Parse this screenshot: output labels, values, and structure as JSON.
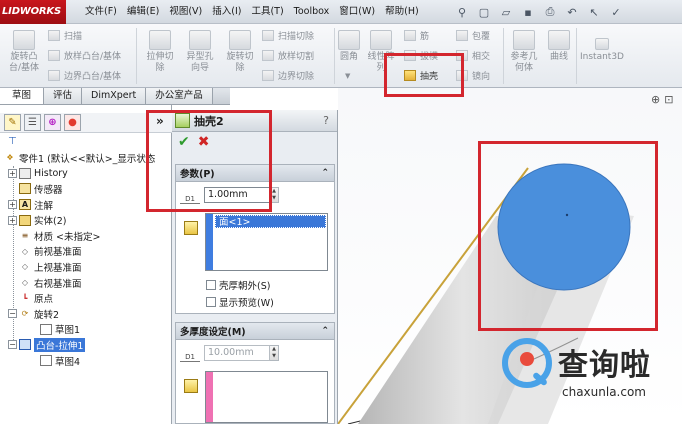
{
  "app": {
    "logo_text": "LIDWORKS"
  },
  "menu": [
    "文件(F)",
    "编辑(E)",
    "视图(V)",
    "插入(I)",
    "工具(T)",
    "Toolbox",
    "窗口(W)",
    "帮助(H)"
  ],
  "quick_access": {
    "icons": [
      "pin-icon",
      "new-document-icon",
      "open-icon",
      "save-icon",
      "print-icon",
      "undo-icon",
      "select-icon",
      "rebuild-icon"
    ]
  },
  "ribbon": {
    "revolve_boss": "旋转凸\n台/基体",
    "sweep": "扫描",
    "loft_boss": "放样凸台/基体",
    "boundary_boss": "边界凸台/基体",
    "extruded_cut": "拉伸切\n除",
    "hole_wizard": "异型孔\n向导",
    "revolved_cut": "旋转切\n除",
    "swept_cut": "扫描切除",
    "lofted_cut": "放样切割",
    "boundary_cut": "边界切除",
    "fillet": "圆角",
    "linear_pattern": "线性阵\n列",
    "rib": "筋",
    "draft": "拔模",
    "shell": "抽壳",
    "wrap": "包覆",
    "intersect": "相交",
    "mirror": "镜向",
    "reference_geometry": "参考几\n何体",
    "curves": "曲线",
    "instant3d": "Instant3D"
  },
  "feature_manager": {
    "tabs": [
      "草图",
      "评估",
      "DimXpert",
      "办公室产品"
    ],
    "tree": [
      {
        "label": "零件1 (默认<<默认>_显示状态",
        "icon": "part-icon",
        "expand": ""
      },
      {
        "label": "History",
        "icon": "history-icon",
        "expand": "+"
      },
      {
        "label": "传感器",
        "icon": "sensor-icon",
        "expand": ""
      },
      {
        "label": "注解",
        "icon": "annotations-icon",
        "expand": "+"
      },
      {
        "label": "实体(2)",
        "icon": "solid-bodies-icon",
        "expand": "+"
      },
      {
        "label": "材质 <未指定>",
        "icon": "material-icon",
        "expand": ""
      },
      {
        "label": "前视基准面",
        "icon": "plane-icon",
        "expand": ""
      },
      {
        "label": "上视基准面",
        "icon": "plane-icon",
        "expand": ""
      },
      {
        "label": "右视基准面",
        "icon": "plane-icon",
        "expand": ""
      },
      {
        "label": "原点",
        "icon": "origin-icon",
        "expand": ""
      },
      {
        "label": "旋转2",
        "icon": "revolve-feature-icon",
        "expand": "−"
      },
      {
        "label": "草图1",
        "icon": "sketch-icon",
        "expand": ""
      },
      {
        "label": "凸台-拉伸1",
        "icon": "extrude-feature-icon",
        "expand": "−",
        "selected": true
      },
      {
        "label": "草图4",
        "icon": "sketch-icon",
        "expand": ""
      }
    ]
  },
  "property_manager": {
    "title": "抽壳2",
    "help": "?",
    "params_header": "参数(P)",
    "thickness": "1.00mm",
    "faces_to_remove": "面<1>",
    "shell_outward": "壳厚朝外(S)",
    "show_preview": "显示预览(W)",
    "multi_header": "多厚度设定(M)",
    "multi_thickness": "10.00mm"
  },
  "watermark": {
    "cn": "查询啦",
    "en": "chaxunla.com"
  },
  "colors": {
    "cylinder_top_face": "#4a8fdc",
    "highlight_box": "#d3262e",
    "selection": "#3a77d8"
  }
}
